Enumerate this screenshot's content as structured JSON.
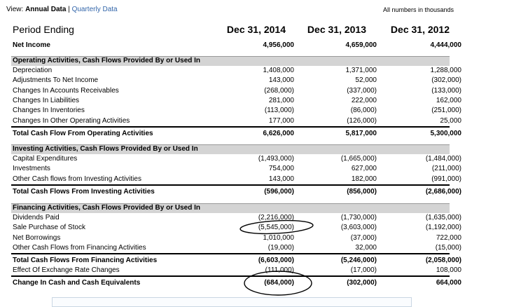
{
  "view": {
    "prefix": "View:",
    "annual": "Annual Data",
    "sep": "|",
    "quarterly": "Quarterly Data"
  },
  "note": "All numbers in thousands",
  "header": {
    "period_label": "Period Ending",
    "columns": [
      "Dec 31, 2014",
      "Dec 31, 2013",
      "Dec 31, 2012"
    ]
  },
  "rows": {
    "net_income": {
      "label": "Net Income",
      "values": [
        "4,956,000",
        "4,659,000",
        "4,444,000"
      ]
    },
    "operating_header": "Operating Activities, Cash Flows Provided By or Used In",
    "operating": [
      {
        "label": "Depreciation",
        "values": [
          "1,408,000",
          "1,371,000",
          "1,288,000"
        ]
      },
      {
        "label": "Adjustments To Net Income",
        "values": [
          "143,000",
          "52,000",
          "(302,000)"
        ]
      },
      {
        "label": "Changes In Accounts Receivables",
        "values": [
          "(268,000)",
          "(337,000)",
          "(133,000)"
        ]
      },
      {
        "label": "Changes In Liabilities",
        "values": [
          "281,000",
          "222,000",
          "162,000"
        ]
      },
      {
        "label": "Changes In Inventories",
        "values": [
          "(113,000)",
          "(86,000)",
          "(251,000)"
        ]
      },
      {
        "label": "Changes In Other Operating Activities",
        "values": [
          "177,000",
          "(126,000)",
          "25,000"
        ]
      }
    ],
    "operating_total": {
      "label": "Total Cash Flow From Operating Activities",
      "values": [
        "6,626,000",
        "5,817,000",
        "5,300,000"
      ]
    },
    "investing_header": "Investing Activities, Cash Flows Provided By or Used In",
    "investing": [
      {
        "label": "Capital Expenditures",
        "values": [
          "(1,493,000)",
          "(1,665,000)",
          "(1,484,000)"
        ]
      },
      {
        "label": "Investments",
        "values": [
          "754,000",
          "627,000",
          "(211,000)"
        ]
      },
      {
        "label": "Other Cash flows from Investing Activities",
        "values": [
          "143,000",
          "182,000",
          "(991,000)"
        ]
      }
    ],
    "investing_total": {
      "label": "Total Cash Flows From Investing Activities",
      "values": [
        "(596,000)",
        "(856,000)",
        "(2,686,000)"
      ]
    },
    "financing_header": "Financing Activities, Cash Flows Provided By or Used In",
    "financing": [
      {
        "label": "Dividends Paid",
        "values": [
          "(2,216,000)",
          "(1,730,000)",
          "(1,635,000)"
        ]
      },
      {
        "label": "Sale Purchase of Stock",
        "values": [
          "(5,545,000)",
          "(3,603,000)",
          "(1,192,000)"
        ]
      },
      {
        "label": "Net Borrowings",
        "values": [
          "1,010,000",
          "(37,000)",
          "722,000"
        ]
      },
      {
        "label": "Other Cash Flows from Financing Activities",
        "values": [
          "(19,000)",
          "32,000",
          "(15,000)"
        ]
      }
    ],
    "financing_total": {
      "label": "Total Cash Flows From Financing Activities",
      "values": [
        "(6,603,000)",
        "(5,246,000)",
        "(2,058,000)"
      ]
    },
    "fx": {
      "label": "Effect Of Exchange Rate Changes",
      "values": [
        "(111,000)",
        "(17,000)",
        "108,000"
      ]
    },
    "change": {
      "label": "Change In Cash and Cash Equivalents",
      "values": [
        "(684,000)",
        "(302,000)",
        "664,000"
      ]
    }
  }
}
